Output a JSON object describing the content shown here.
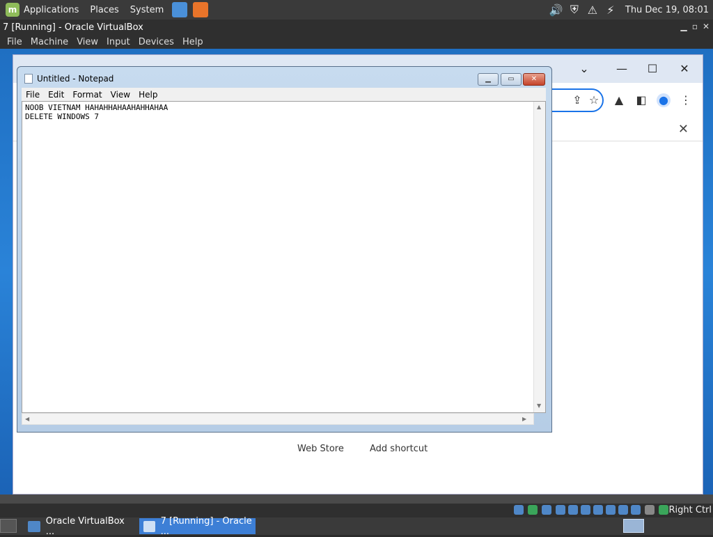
{
  "top_panel": {
    "menus": [
      "Applications",
      "Places",
      "System"
    ],
    "clock": "Thu Dec 19, 08:01"
  },
  "vbox": {
    "title": "7 [Running] - Oracle VirtualBox",
    "menu": [
      "File",
      "Machine",
      "View",
      "Input",
      "Devices",
      "Help"
    ],
    "host_key": "Right Ctrl"
  },
  "notepad": {
    "title": "Untitled - Notepad",
    "menu": [
      "File",
      "Edit",
      "Format",
      "View",
      "Help"
    ],
    "content": "NOOB VIETNAM HAHAHHAHAAHAHHAHAA\nDELETE WINDOWS 7"
  },
  "chrome": {
    "shortcuts": [
      "Web Store",
      "Add shortcut"
    ]
  },
  "taskbar": {
    "tasks": [
      {
        "label": "Oracle VirtualBox ...",
        "active": false
      },
      {
        "label": "7 [Running] - Oracle ...",
        "active": true
      }
    ]
  },
  "colors": {
    "accent": "#3d7fd6",
    "desktop": "#2a83d8",
    "panel": "#3a3a3a"
  }
}
